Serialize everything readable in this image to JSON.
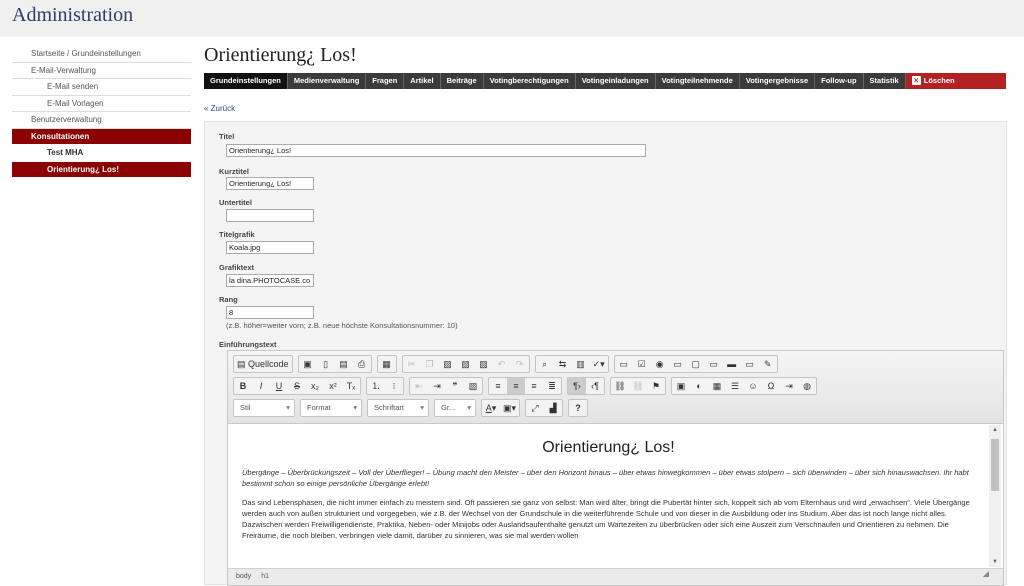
{
  "app_title": "Administration",
  "sidebar": {
    "items": [
      {
        "label": "Startseite / Grundeinstellungen"
      },
      {
        "label": "E-Mail-Verwaltung"
      },
      {
        "label": "E-Mail senden"
      },
      {
        "label": "E-Mail Vorlagen"
      },
      {
        "label": "Benutzerverwaltung"
      },
      {
        "label": "Konsultationen"
      },
      {
        "label": "Test MHA"
      },
      {
        "label": "Orientierung¿ Los!"
      }
    ]
  },
  "page_title": "Orientierung¿ Los!",
  "tabs": [
    {
      "label": "Grundeinstellungen"
    },
    {
      "label": "Medienverwaltung"
    },
    {
      "label": "Fragen"
    },
    {
      "label": "Artikel"
    },
    {
      "label": "Beiträge"
    },
    {
      "label": "Votingberechtigungen"
    },
    {
      "label": "Votingeinladungen"
    },
    {
      "label": "Votingteilnehmende"
    },
    {
      "label": "Votingergebnisse"
    },
    {
      "label": "Follow-up"
    },
    {
      "label": "Statistik"
    },
    {
      "label": "Löschen"
    }
  ],
  "back_link": "« Zurück",
  "form": {
    "titel_label": "Titel",
    "titel_value": "Orientierung¿ Los!",
    "kurztitel_label": "Kurztitel",
    "kurztitel_value": "Orientierung¿ Los!",
    "untertitel_label": "Untertitel",
    "untertitel_value": "",
    "titelgrafik_label": "Titelgrafik",
    "titelgrafik_value": "Koala.jpg",
    "grafiktext_label": "Grafiktext",
    "grafiktext_value": "la dina.PHOTOCASE.co",
    "rang_label": "Rang",
    "rang_value": "8",
    "rang_hint": "(z.B. höher=weiter vorn; z.B. neue höchste Konsultationsnummer: 10)",
    "einfuehrung_label": "Einführungstext"
  },
  "editor": {
    "source_label": "Quellcode",
    "combo_stil": "Stil",
    "combo_format": "Format",
    "combo_schriftart": "Schriftart",
    "combo_groesse": "Gr...",
    "heading": "Orientierung¿ Los!",
    "intro": "Übergänge – Überbrückungszeit – Voll der Überflieger! – Übung macht den Meister – über den Horizont hinaus – über etwas hinwegkommen – über etwas stolpern – sich überwinden – über sich hinauswachsen. Ihr habt bestimmt schon so einige persönliche Übergänge erlebt!",
    "paragraph": "Das sind Lebensphasen, die nicht immer einfach zu meistern sind. Oft passieren sie ganz von selbst: Man wird älter, bringt die Pubertät hinter sich, koppelt sich ab vom Elternhaus und wird „erwachsen“. Viele Übergänge werden auch von außen strukturiert und vorgegeben, wie z.B. der Wechsel von der Grundschule in die weiterführende Schule und von dieser in die Ausbildung oder ins Studium. Aber das ist noch lange nicht alles. Dazwischen werden Freiwilligendienste, Praktika, Neben- oder Minijobs oder Auslandsaufenthalte genutzt um Wartezeiten zu überbrücken oder sich eine Auszeit zum Verschnaufen und Orientieren zu nehmen. Die Freiräume, die noch bleiben, verbringen viele damit, darüber zu sinnieren, was sie mal werden wollen",
    "status_body": "body",
    "status_h1": "h1"
  }
}
